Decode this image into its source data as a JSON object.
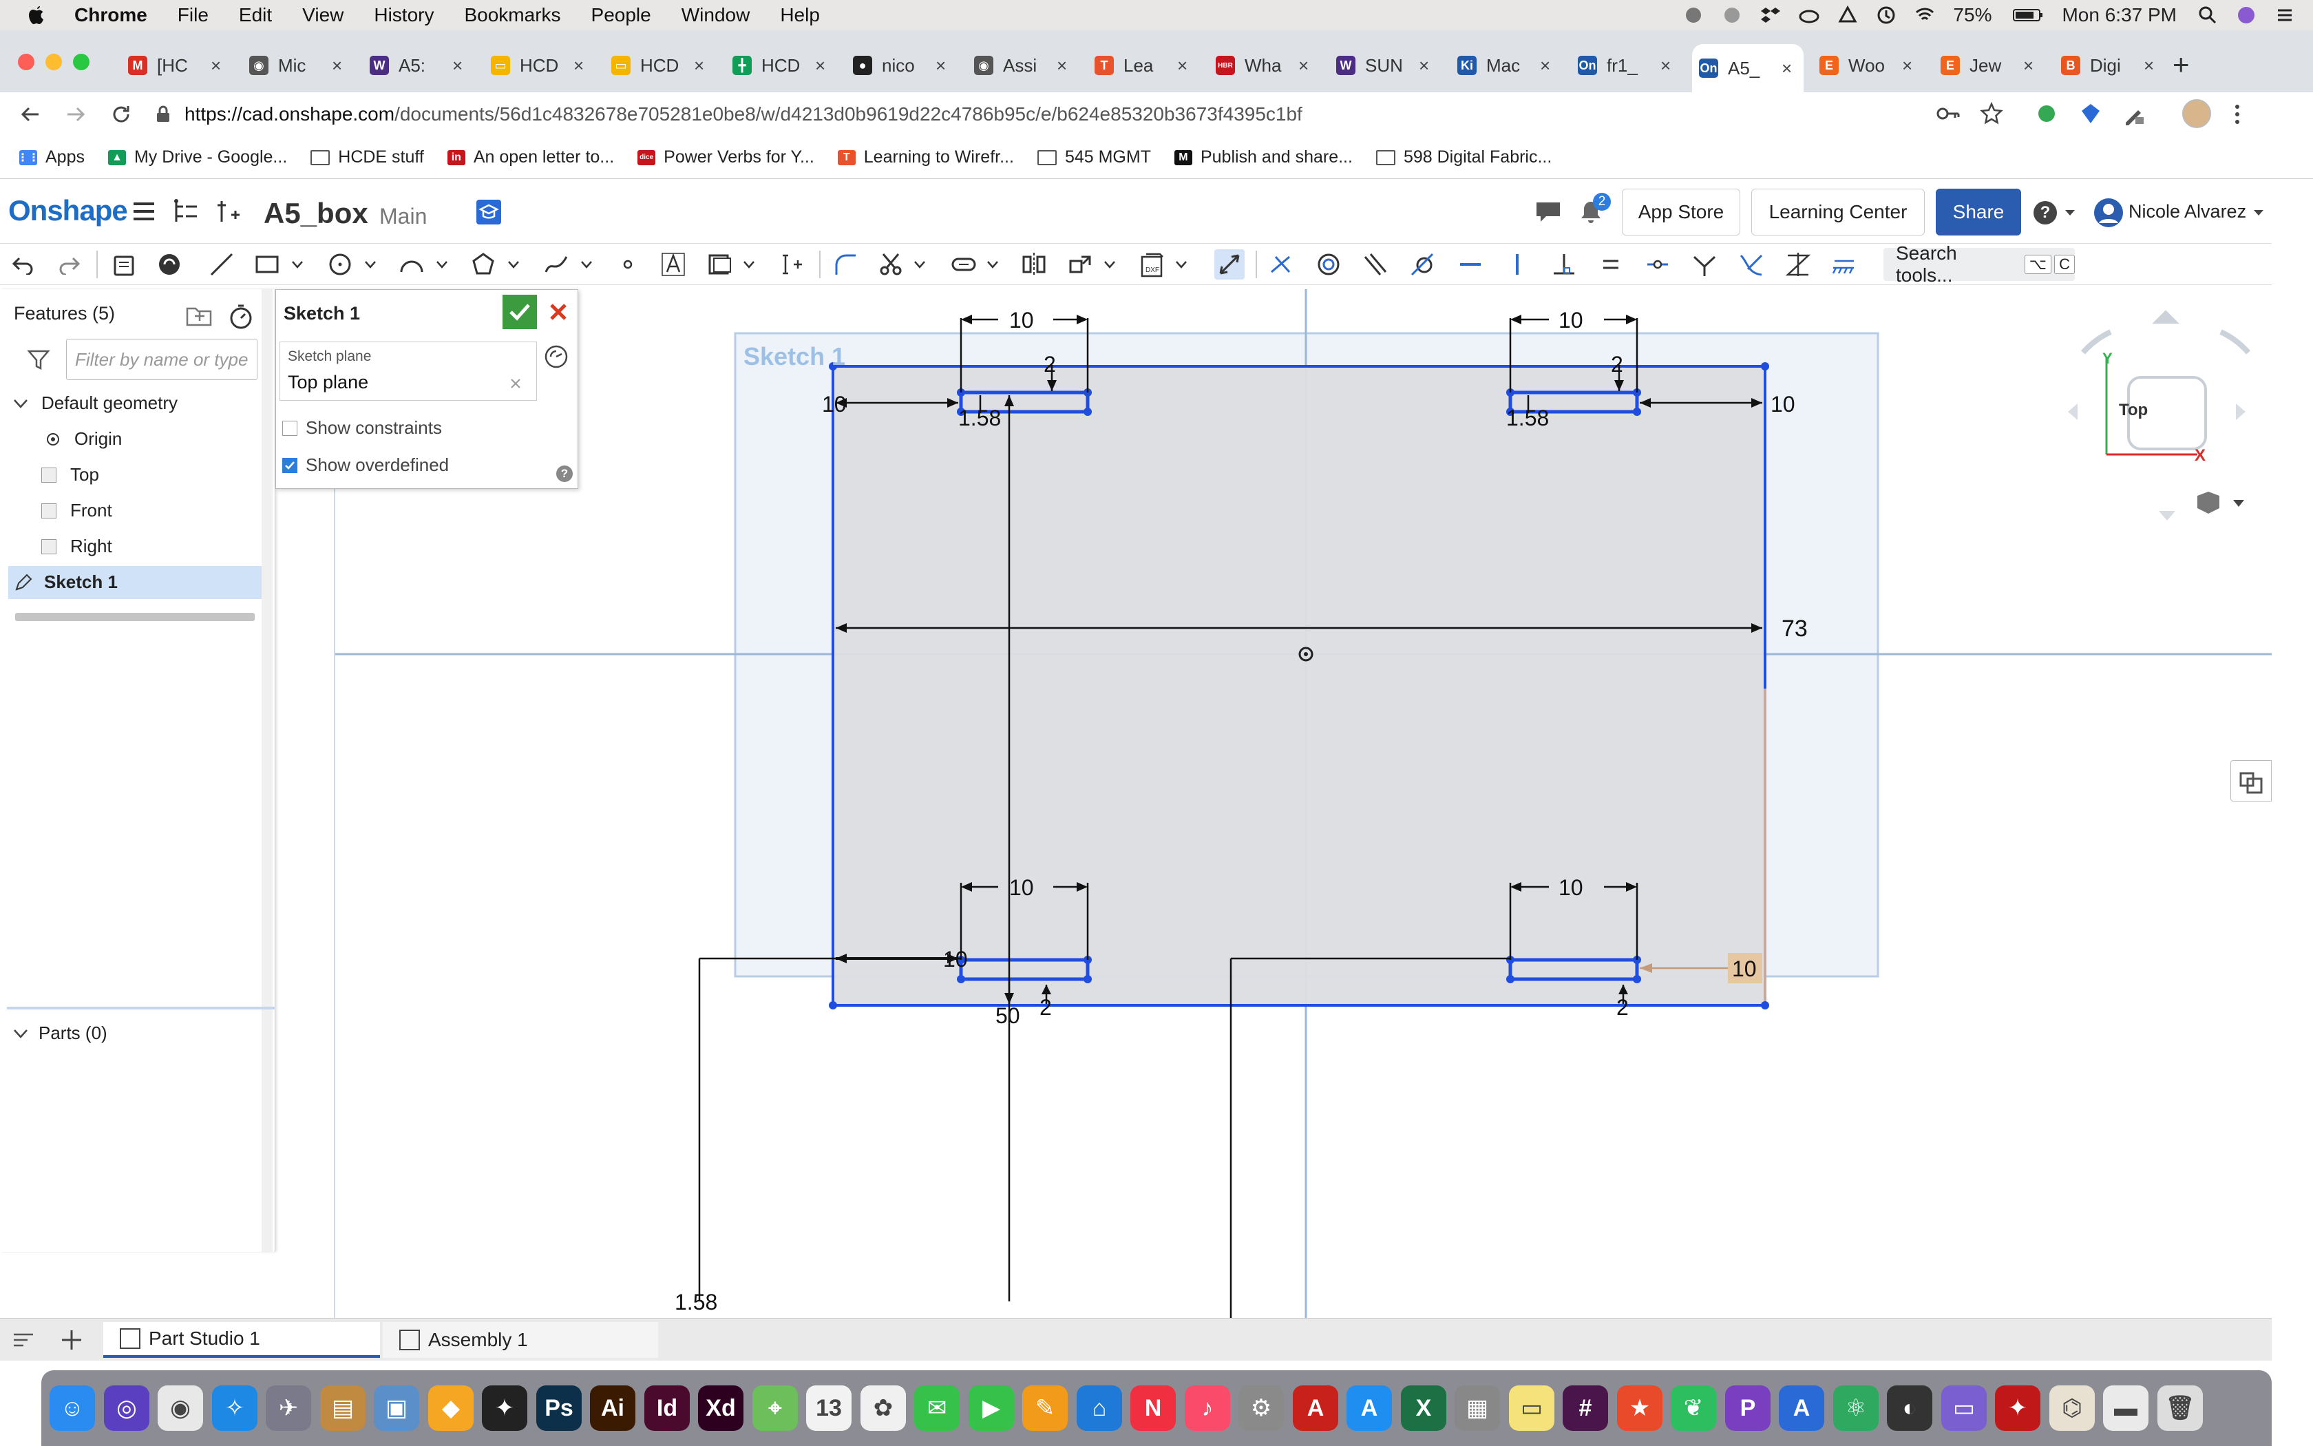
{
  "menubar": {
    "app": "Chrome",
    "items": [
      "File",
      "Edit",
      "View",
      "History",
      "Bookmarks",
      "People",
      "Window",
      "Help"
    ],
    "battery": "75%",
    "clock": "Mon 6:37 PM"
  },
  "tabs": [
    {
      "label": "[HC",
      "color": "#d93025",
      "glyph": "M"
    },
    {
      "label": "Mic",
      "color": "#555555",
      "glyph": "◉"
    },
    {
      "label": "A5:",
      "color": "#4b2e83",
      "glyph": "W"
    },
    {
      "label": "HCD",
      "color": "#f4b400",
      "glyph": "▭"
    },
    {
      "label": "HCD",
      "color": "#f4b400",
      "glyph": "▭"
    },
    {
      "label": "HCD",
      "color": "#0f9d58",
      "glyph": "╋"
    },
    {
      "label": "nico",
      "color": "#222222",
      "glyph": "●"
    },
    {
      "label": "Assi",
      "color": "#555555",
      "glyph": "◉"
    },
    {
      "label": "Lea",
      "color": "#e8532d",
      "glyph": "T"
    },
    {
      "label": "Wha",
      "color": "#c4161c",
      "glyph": "HBR"
    },
    {
      "label": "SUN",
      "color": "#4b2e83",
      "glyph": "W"
    },
    {
      "label": "Mac",
      "color": "#1e5aa8",
      "glyph": "Ki"
    },
    {
      "label": "fr1_",
      "color": "#1e5aa8",
      "glyph": "On"
    },
    {
      "label": "A5_",
      "color": "#1e5aa8",
      "glyph": "On"
    },
    {
      "label": "Woo",
      "color": "#f1641e",
      "glyph": "E"
    },
    {
      "label": "Jew",
      "color": "#f1641e",
      "glyph": "E"
    },
    {
      "label": "Digi",
      "color": "#e65722",
      "glyph": "B"
    }
  ],
  "address": {
    "host": "https://cad.onshape.com",
    "path": "/documents/56d1c4832678e705281e0be8/w/d4213d0b9619d22c4786b95c/e/b624e85320b3673f4395c1bf"
  },
  "bookmarks": [
    {
      "label": "Apps",
      "color": "#4285f4",
      "glyph": "⋮⋮"
    },
    {
      "label": "My Drive - Google...",
      "color": "#0f9d58",
      "glyph": "▲"
    },
    {
      "label": "HCDE stuff",
      "color": "folder",
      "glyph": ""
    },
    {
      "label": "An open letter to...",
      "color": "#c4161c",
      "glyph": "in"
    },
    {
      "label": "Power Verbs for Y...",
      "color": "#c4161c",
      "glyph": "dice"
    },
    {
      "label": "Learning to Wirefr...",
      "color": "#e8532d",
      "glyph": "T"
    },
    {
      "label": "545 MGMT",
      "color": "folder",
      "glyph": ""
    },
    {
      "label": "Publish and share...",
      "color": "#111111",
      "glyph": "M"
    },
    {
      "label": "598 Digital Fabric...",
      "color": "folder",
      "glyph": ""
    }
  ],
  "onshape": {
    "logo": "Onshape",
    "document": "A5_box",
    "branch": "Main",
    "notifications": "2",
    "app_store": "App Store",
    "learning_center": "Learning Center",
    "share": "Share",
    "help": "?",
    "user": "Nicole Alvarez"
  },
  "toolbar": {
    "search_label": "Search tools...",
    "search_key1": "⌥",
    "search_key2": "C"
  },
  "features": {
    "title": "Features (5)",
    "filter_placeholder": "Filter by name or type",
    "default_geometry": "Default geometry",
    "origin": "Origin",
    "top": "Top",
    "front": "Front",
    "right": "Right",
    "sketch": "Sketch 1",
    "parts": "Parts (0)"
  },
  "sketch_dialog": {
    "title": "Sketch 1",
    "plane_label": "Sketch plane",
    "plane_value": "Top plane",
    "show_constraints": "Show constraints",
    "show_overdefined": "Show overdefined",
    "help": "?"
  },
  "canvas": {
    "sketch_label": "Sketch 1",
    "dims": {
      "top_left_width": "10",
      "top_right_width": "10",
      "top_left_height": "2",
      "top_right_height": "2",
      "left_offset": "10",
      "right_offset": "10",
      "top_left_depth": "1.58",
      "top_right_depth": "1.58",
      "overall_width": "73",
      "bottom_left_width": "10",
      "bottom_right_width": "10",
      "bottom_left_offset": "10",
      "bottom_right_offset": "10",
      "bottom_height_left": "2",
      "bottom_height_right": "2",
      "bottom_dim_50": "50",
      "lower_left_depth": "1.58"
    },
    "view_cube": "Top",
    "axis_x": "X",
    "axis_y": "Y"
  },
  "bottom_tabs": [
    {
      "label": "Part Studio 1"
    },
    {
      "label": "Assembly 1"
    }
  ],
  "dock": [
    {
      "name": "finder",
      "color": "#2a8cf0",
      "glyph": "☺"
    },
    {
      "name": "siri",
      "color": "#5a3fc0",
      "glyph": "◎"
    },
    {
      "name": "chrome",
      "color": "#e8e8e8",
      "glyph": "◉"
    },
    {
      "name": "safari",
      "color": "#1e88e5",
      "glyph": "✧"
    },
    {
      "name": "launchpad",
      "color": "#7a7a8a",
      "glyph": "✈"
    },
    {
      "name": "notes",
      "color": "#c08a40",
      "glyph": "▤"
    },
    {
      "name": "preview",
      "color": "#5b8fc9",
      "glyph": "▣"
    },
    {
      "name": "sketch",
      "color": "#f5a623",
      "glyph": "◆"
    },
    {
      "name": "figma",
      "color": "#222222",
      "glyph": "✦"
    },
    {
      "name": "photoshop",
      "color": "#0c2f4a",
      "glyph": "Ps"
    },
    {
      "name": "illustrator",
      "color": "#3a1a00",
      "glyph": "Ai"
    },
    {
      "name": "indesign",
      "color": "#4a0a2e",
      "glyph": "Id"
    },
    {
      "name": "xd",
      "color": "#2e001f",
      "glyph": "Xd"
    },
    {
      "name": "maps",
      "color": "#6cbf5a",
      "glyph": "⌖"
    },
    {
      "name": "calendar",
      "color": "#f2f2f2",
      "glyph": "13"
    },
    {
      "name": "photos",
      "color": "#f0f0f0",
      "glyph": "✿"
    },
    {
      "name": "messages",
      "color": "#36c24a",
      "glyph": "✉"
    },
    {
      "name": "facetime",
      "color": "#36c24a",
      "glyph": "▶"
    },
    {
      "name": "pages",
      "color": "#f29a1a",
      "glyph": "✎"
    },
    {
      "name": "keynote",
      "color": "#1e7ad6",
      "glyph": "⌂"
    },
    {
      "name": "news",
      "color": "#f03040",
      "glyph": "N"
    },
    {
      "name": "music",
      "color": "#fa4c6a",
      "glyph": "♪"
    },
    {
      "name": "system-prefs",
      "color": "#8a8a8a",
      "glyph": "⚙"
    },
    {
      "name": "acrobat",
      "color": "#c8201a",
      "glyph": "A"
    },
    {
      "name": "app-store",
      "color": "#1f8ef1",
      "glyph": "A"
    },
    {
      "name": "excel",
      "color": "#1d7044",
      "glyph": "X"
    },
    {
      "name": "files",
      "color": "#888888",
      "glyph": "▦"
    },
    {
      "name": "stickies",
      "color": "#f5e27a",
      "glyph": "▭"
    },
    {
      "name": "slack",
      "color": "#4a154b",
      "glyph": "#"
    },
    {
      "name": "todo",
      "color": "#e84a2a",
      "glyph": "★"
    },
    {
      "name": "evernote",
      "color": "#2dbe60",
      "glyph": "❦"
    },
    {
      "name": "producthunt",
      "color": "#7a3fc0",
      "glyph": "P"
    },
    {
      "name": "testflight",
      "color": "#2a6ad6",
      "glyph": "A"
    },
    {
      "name": "atom",
      "color": "#2fa860",
      "glyph": "⚛"
    },
    {
      "name": "github",
      "color": "#333333",
      "glyph": "◐"
    },
    {
      "name": "wallet",
      "color": "#7a5fd0",
      "glyph": "▭"
    },
    {
      "name": "rocket",
      "color": "#c01818",
      "glyph": "✦"
    },
    {
      "name": "hype",
      "color": "#e8e0d0",
      "glyph": "⌬"
    },
    {
      "name": "downloads",
      "color": "#eaeaea",
      "glyph": "▬"
    },
    {
      "name": "trash",
      "color": "#dddddd",
      "glyph": "🗑"
    }
  ],
  "colors": {
    "onshape_blue": "#1d6dc6",
    "sketch_blue": "#1f4de0",
    "share_blue": "#2a5db0",
    "ok_green": "#3c9a3f",
    "cancel_red": "#d9391e"
  }
}
